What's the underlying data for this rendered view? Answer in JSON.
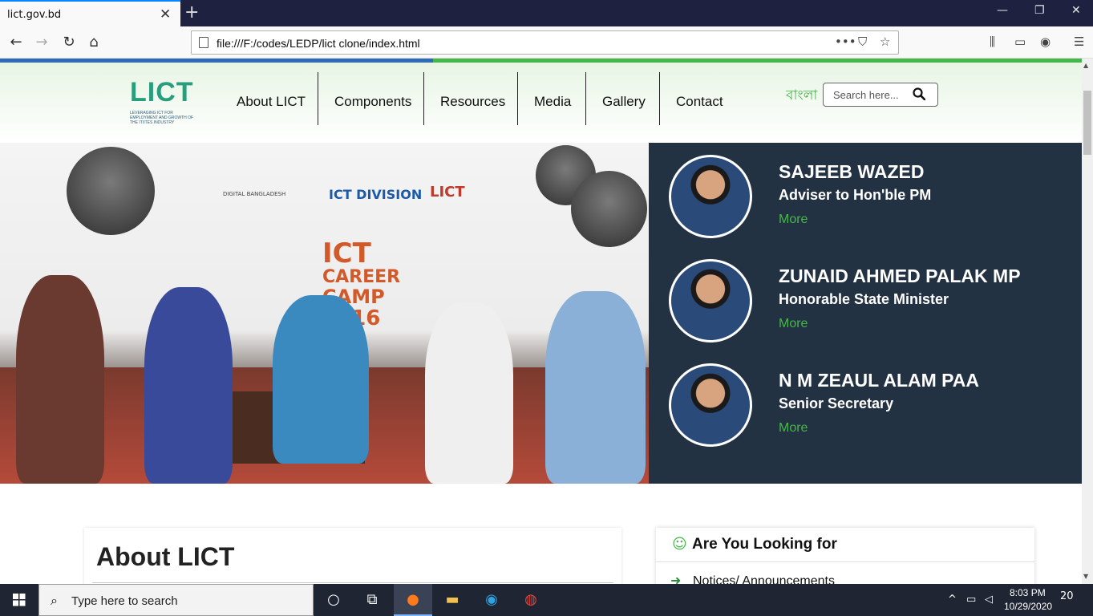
{
  "browser": {
    "tab_title": "lict.gov.bd",
    "tab_close": "✕",
    "new_tab": "+",
    "url": "file:///F:/codes/LEDP/lict clone/index.html",
    "window_controls": [
      "—",
      "❐",
      "✕"
    ]
  },
  "site": {
    "logo_text": "LICT",
    "logo_subtitle": "LEVERAGING ICT FOR EMPLOYMENT AND GROWTH OF THE IT/ITES INDUSTRY",
    "menu": [
      "About LICT",
      "Components",
      "Resources",
      "Media",
      "Gallery",
      "Contact"
    ],
    "language_toggle": "বাংলা",
    "search_placeholder": "Search here..."
  },
  "hero": {
    "banner": {
      "ict": "ICT",
      "career": "CAREER",
      "camp": "CAMP",
      "year": "2016",
      "logos": [
        "DIGITAL BANGLADESH",
        "ICT DIVISION",
        "LICT"
      ]
    }
  },
  "leaders": [
    {
      "name": "SAJEEB WAZED",
      "role": "Adviser to Hon'ble PM",
      "more": "More"
    },
    {
      "name": "ZUNAID AHMED PALAK MP",
      "role": "Honorable State Minister",
      "more": "More"
    },
    {
      "name": "N M ZEAUL ALAM PAA",
      "role": "Senior Secretary",
      "more": "More"
    }
  ],
  "about": {
    "title": "About LICT"
  },
  "looking_for": {
    "title": "Are You Looking for",
    "items": [
      "Notices/ Announcements"
    ]
  },
  "taskbar": {
    "search_text": "Type here to search",
    "time": "8:03 PM",
    "date": "10/29/2020",
    "notifications": "20"
  },
  "colors": {
    "brand_green": "#45b649",
    "brand_blue": "#2e6bb7",
    "leaders_bg": "#233242"
  }
}
